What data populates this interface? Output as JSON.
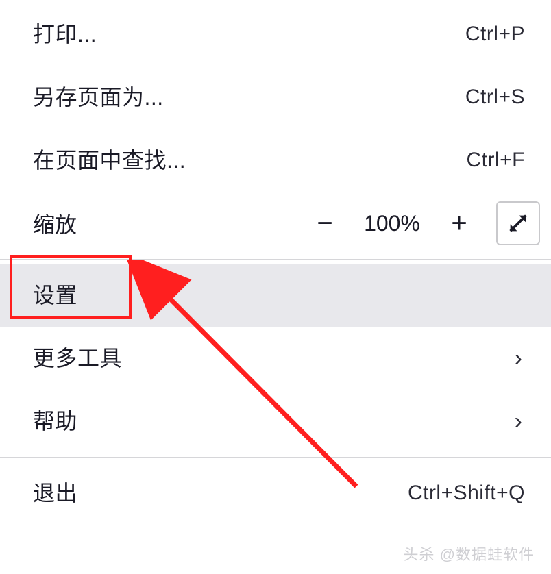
{
  "menu": {
    "print": {
      "label": "打印...",
      "shortcut": "Ctrl+P"
    },
    "save_as": {
      "label": "另存页面为...",
      "shortcut": "Ctrl+S"
    },
    "find": {
      "label": "在页面中查找...",
      "shortcut": "Ctrl+F"
    },
    "zoom": {
      "label": "缩放",
      "value": "100%"
    },
    "settings": {
      "label": "设置"
    },
    "more_tools": {
      "label": "更多工具"
    },
    "help": {
      "label": "帮助"
    },
    "exit": {
      "label": "退出",
      "shortcut": "Ctrl+Shift+Q"
    }
  },
  "watermark": "头杀 @数据蛙软件",
  "annotation": {
    "highlight_color": "#ff1f1f"
  }
}
